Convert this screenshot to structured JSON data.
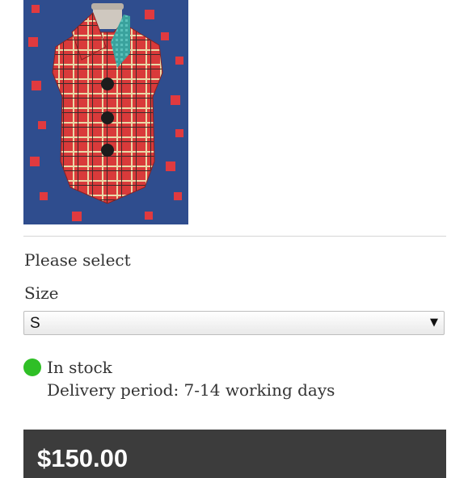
{
  "product": {
    "image_alt": "product-photo"
  },
  "options": {
    "please_select": "Please select",
    "size_label": "Size",
    "size_selected": "S"
  },
  "availability": {
    "status": "In stock",
    "delivery": "Delivery period: 7-14 working days",
    "status_color": "#2fbf26"
  },
  "purchase": {
    "price": "$150.00"
  }
}
